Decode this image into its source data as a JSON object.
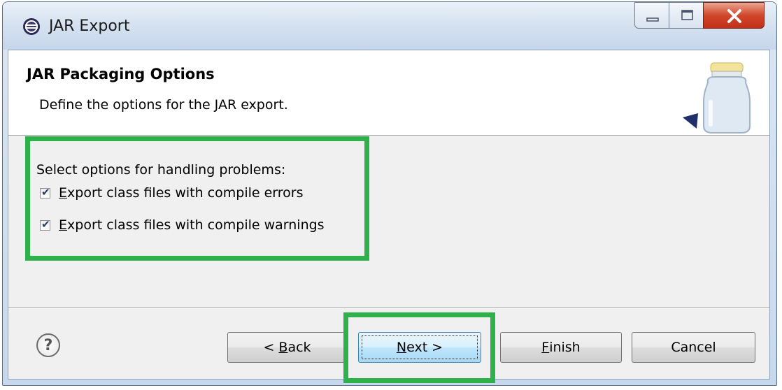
{
  "window": {
    "title": "JAR Export"
  },
  "header": {
    "title": "JAR Packaging Options",
    "description": "Define the options for the JAR export."
  },
  "options": {
    "group_label": "Select options for handling problems:",
    "items": [
      {
        "mnemonic": "E",
        "rest": "xport class files with compile errors",
        "checked": true
      },
      {
        "mnemonic": "E",
        "rest": "xport class files with compile warnings",
        "checked": true
      }
    ]
  },
  "buttons": {
    "back": {
      "prefix": "< ",
      "mnemonic": "B",
      "rest": "ack"
    },
    "next": {
      "mnemonic": "N",
      "rest": "ext >"
    },
    "finish": {
      "mnemonic": "F",
      "rest": "inish"
    },
    "cancel": {
      "label": "Cancel"
    }
  },
  "help_glyph": "?",
  "colors": {
    "highlight": "#2eb14a"
  }
}
